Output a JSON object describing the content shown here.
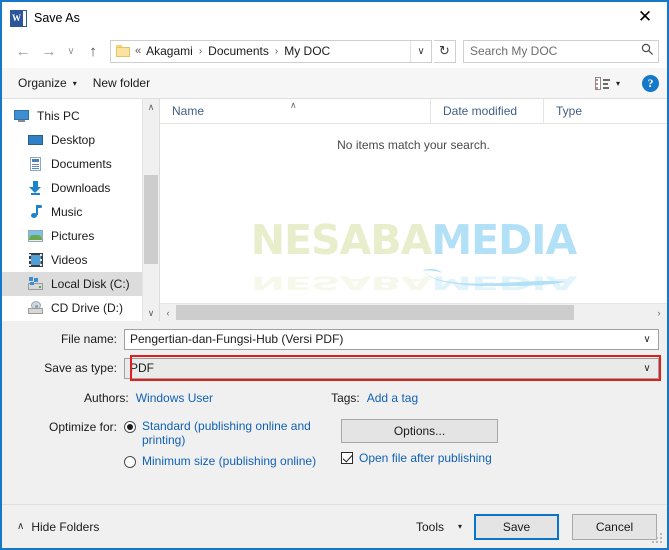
{
  "window": {
    "title": "Save As",
    "app_icon": "word-icon",
    "close_label": "✕"
  },
  "navigation": {
    "back_label": "←",
    "forward_label": "→",
    "recent_label": "∨",
    "up_label": "↑",
    "breadcrumb_prefix": "«",
    "breadcrumbs": [
      "Akagami",
      "Documents",
      "My DOC"
    ],
    "separator": "›",
    "dropdown_label": "∨",
    "refresh_label": "↻"
  },
  "search": {
    "placeholder": "Search My DOC",
    "value": "",
    "icon": "search-icon"
  },
  "toolbar": {
    "organize_label": "Organize",
    "new_folder_label": "New folder",
    "caret": "▾",
    "view_icon": "list-view-icon",
    "help_label": "?"
  },
  "sidebar": {
    "items": [
      {
        "label": "This PC",
        "icon": "computer-icon",
        "indent": false,
        "selected": false
      },
      {
        "label": "Desktop",
        "icon": "desktop-icon",
        "indent": true,
        "selected": false
      },
      {
        "label": "Documents",
        "icon": "documents-icon",
        "indent": true,
        "selected": false
      },
      {
        "label": "Downloads",
        "icon": "downloads-icon",
        "indent": true,
        "selected": false
      },
      {
        "label": "Music",
        "icon": "music-icon",
        "indent": true,
        "selected": false
      },
      {
        "label": "Pictures",
        "icon": "pictures-icon",
        "indent": true,
        "selected": false
      },
      {
        "label": "Videos",
        "icon": "videos-icon",
        "indent": true,
        "selected": false
      },
      {
        "label": "Local Disk (C:)",
        "icon": "harddisk-icon",
        "indent": true,
        "selected": true
      },
      {
        "label": "CD Drive (D:)",
        "icon": "cddrive-icon",
        "indent": true,
        "selected": false
      }
    ],
    "scroll_up": "∧",
    "scroll_down": "∨"
  },
  "filelist": {
    "columns": [
      "Name",
      "Date modified",
      "Type"
    ],
    "sort_indicator": "∧",
    "empty_message": "No items match your search.",
    "rows": [],
    "hscroll_left": "‹",
    "hscroll_right": "›"
  },
  "watermark": {
    "part1": "NESABA",
    "part2": "MEDIA",
    "color1": "#e8edcb",
    "color2": "#b2e0f7"
  },
  "form": {
    "filename_label": "File name:",
    "filename_value": "Pengertian-dan-Fungsi-Hub (Versi PDF)",
    "filetype_label": "Save as type:",
    "filetype_value": "PDF",
    "combo_arrow": "∨",
    "highlight_color": "#e01e1e",
    "authors_label": "Authors:",
    "authors_value": "Windows User",
    "tags_label": "Tags:",
    "tags_value": "Add a tag"
  },
  "optimize": {
    "label": "Optimize for:",
    "options": [
      {
        "label": "Standard (publishing online and printing)",
        "selected": true
      },
      {
        "label": "Minimum size (publishing online)",
        "selected": false
      }
    ],
    "options_button": "Options...",
    "open_after_label": "Open file after publishing",
    "open_after_checked": true
  },
  "footer": {
    "hide_folders_label": "Hide Folders",
    "hide_folders_chevron": "∧",
    "tools_label": "Tools",
    "tools_caret": "▾",
    "save_label": "Save",
    "cancel_label": "Cancel"
  }
}
